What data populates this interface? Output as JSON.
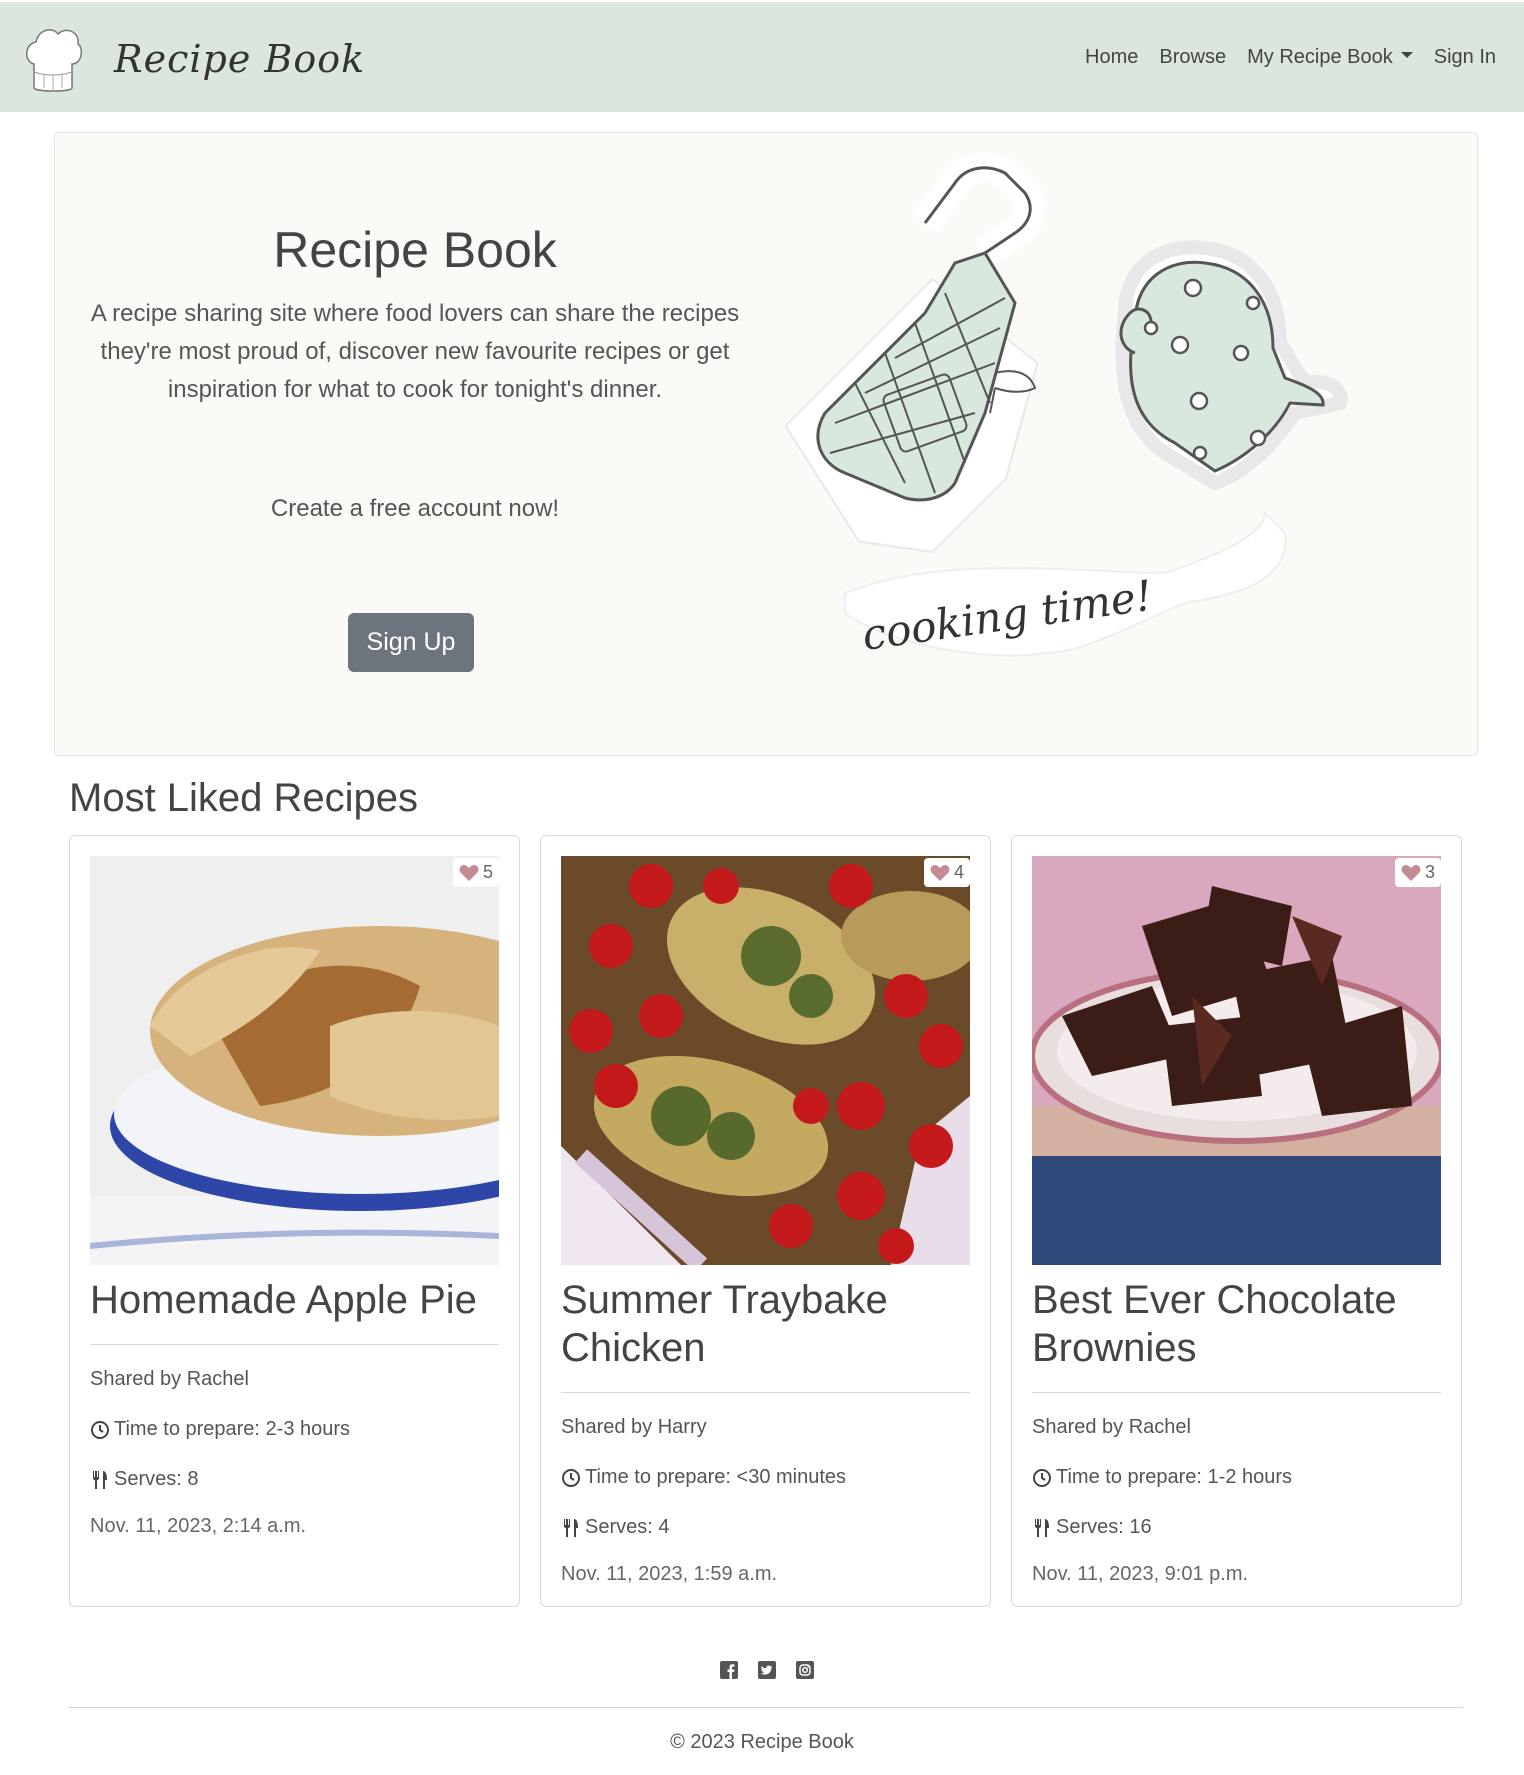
{
  "nav": {
    "brand": "Recipe Book",
    "links": [
      "Home",
      "Browse",
      "My Recipe Book",
      "Sign In"
    ]
  },
  "hero": {
    "title": "Recipe Book",
    "description": "A recipe sharing site where food lovers can share the recipes they're most proud of, discover new favourite recipes or get inspiration for what to cook for tonight's dinner.",
    "cta": "Create a free account now!",
    "button": "Sign Up",
    "illustration_text": "cooking time!"
  },
  "section_title": "Most Liked Recipes",
  "recipes": [
    {
      "title": "Homemade Apple Pie",
      "likes": "5",
      "shared_by": "Shared by Rachel",
      "time": "Time to prepare: 2-3 hours",
      "serves": "Serves: 8",
      "date": "Nov. 11, 2023, 2:14 a.m."
    },
    {
      "title": "Summer Traybake Chicken",
      "likes": "4",
      "shared_by": "Shared by Harry",
      "time": "Time to prepare: <30 minutes",
      "serves": "Serves: 4",
      "date": "Nov. 11, 2023, 1:59 a.m."
    },
    {
      "title": "Best Ever Chocolate Brownies",
      "likes": "3",
      "shared_by": "Shared by Rachel",
      "time": "Time to prepare: 1-2 hours",
      "serves": "Serves: 16",
      "date": "Nov. 11, 2023, 9:01 p.m."
    }
  ],
  "footer": {
    "socials": [
      "facebook-icon",
      "twitter-icon",
      "instagram-icon"
    ],
    "copyright": "© 2023 Recipe Book"
  },
  "colors": {
    "navbar": "#dbe7dc",
    "hero_bg": "#fbfaf6",
    "button": "#6c757d",
    "heart": "#c48b93",
    "mint": "#d8e8dc"
  }
}
